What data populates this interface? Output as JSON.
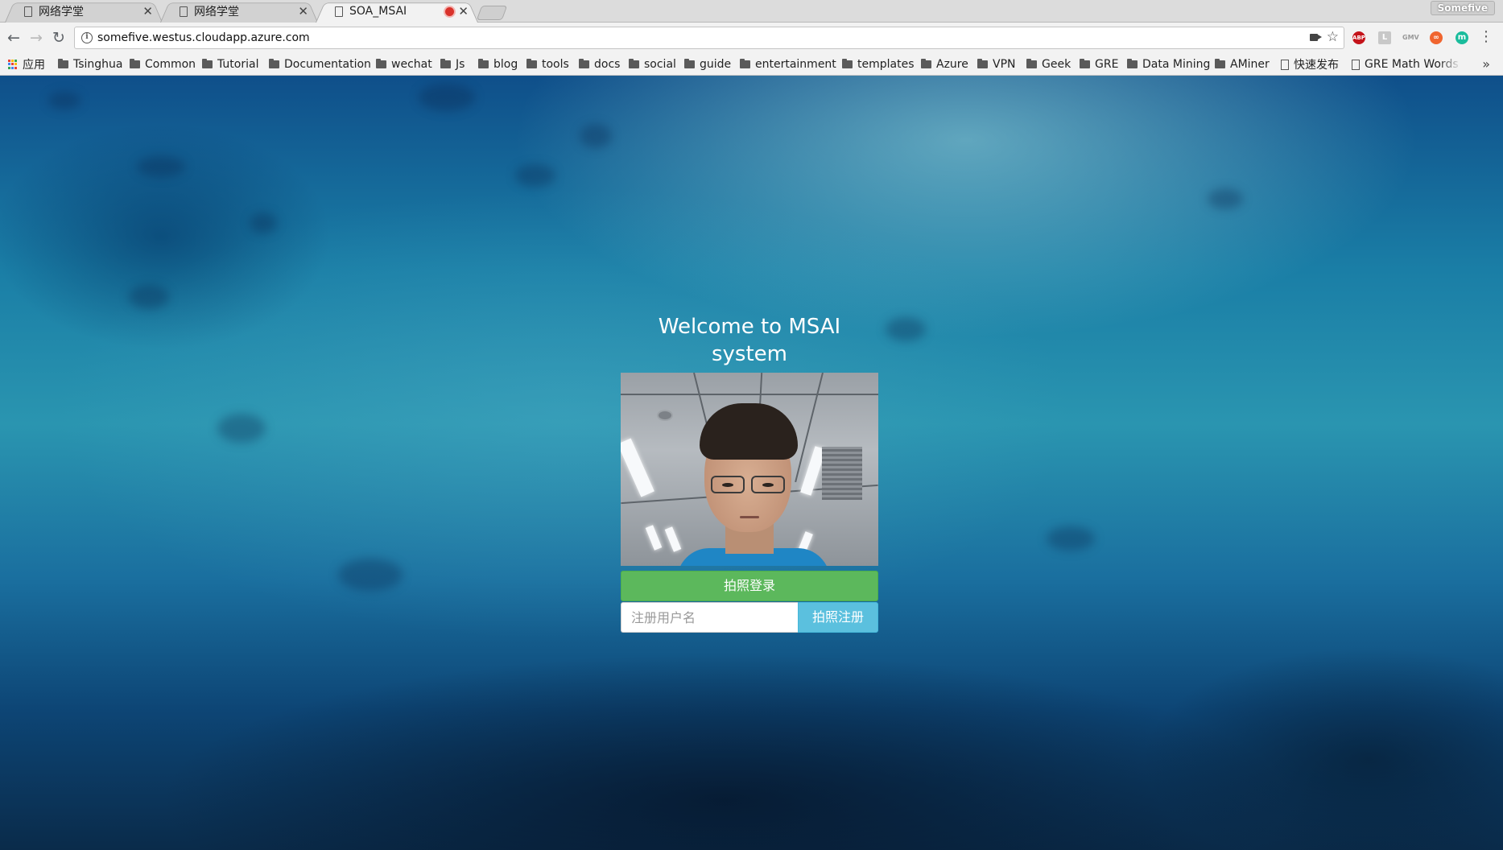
{
  "tabs": [
    {
      "title": "网络学堂",
      "active": false
    },
    {
      "title": "网络学堂",
      "active": false
    },
    {
      "title": "SOA_MSAI",
      "active": true,
      "recording": true
    }
  ],
  "profile": {
    "name": "Somefive"
  },
  "address_bar": {
    "url": "somefive.westus.cloudapp.azure.com"
  },
  "extensions": [
    "ABP",
    "L",
    "GMV",
    "∞",
    "m"
  ],
  "bookmarks": {
    "apps_label": "应用",
    "items": [
      {
        "label": "Tsinghua",
        "type": "folder"
      },
      {
        "label": "Common",
        "type": "folder"
      },
      {
        "label": "Tutorial",
        "type": "folder"
      },
      {
        "label": "Documentation",
        "type": "folder"
      },
      {
        "label": "wechat",
        "type": "folder"
      },
      {
        "label": "Js",
        "type": "folder"
      },
      {
        "label": "blog",
        "type": "folder"
      },
      {
        "label": "tools",
        "type": "folder"
      },
      {
        "label": "docs",
        "type": "folder"
      },
      {
        "label": "social",
        "type": "folder"
      },
      {
        "label": "guide",
        "type": "folder"
      },
      {
        "label": "entertainment",
        "type": "folder"
      },
      {
        "label": "templates",
        "type": "folder"
      },
      {
        "label": "Azure",
        "type": "folder"
      },
      {
        "label": "VPN",
        "type": "folder"
      },
      {
        "label": "Geek",
        "type": "folder"
      },
      {
        "label": "GRE",
        "type": "folder"
      },
      {
        "label": "Data Mining",
        "type": "folder"
      },
      {
        "label": "AMiner",
        "type": "folder"
      },
      {
        "label": "快速发布",
        "type": "page"
      },
      {
        "label": "GRE Math Words",
        "type": "page"
      }
    ]
  },
  "page": {
    "heading": "Welcome to MSAI system",
    "login_button": "拍照登录",
    "register_input_placeholder": "注册用户名",
    "register_button": "拍照注册"
  },
  "colors": {
    "login_green": "#5cb85c",
    "register_blue": "#5bc0de"
  }
}
